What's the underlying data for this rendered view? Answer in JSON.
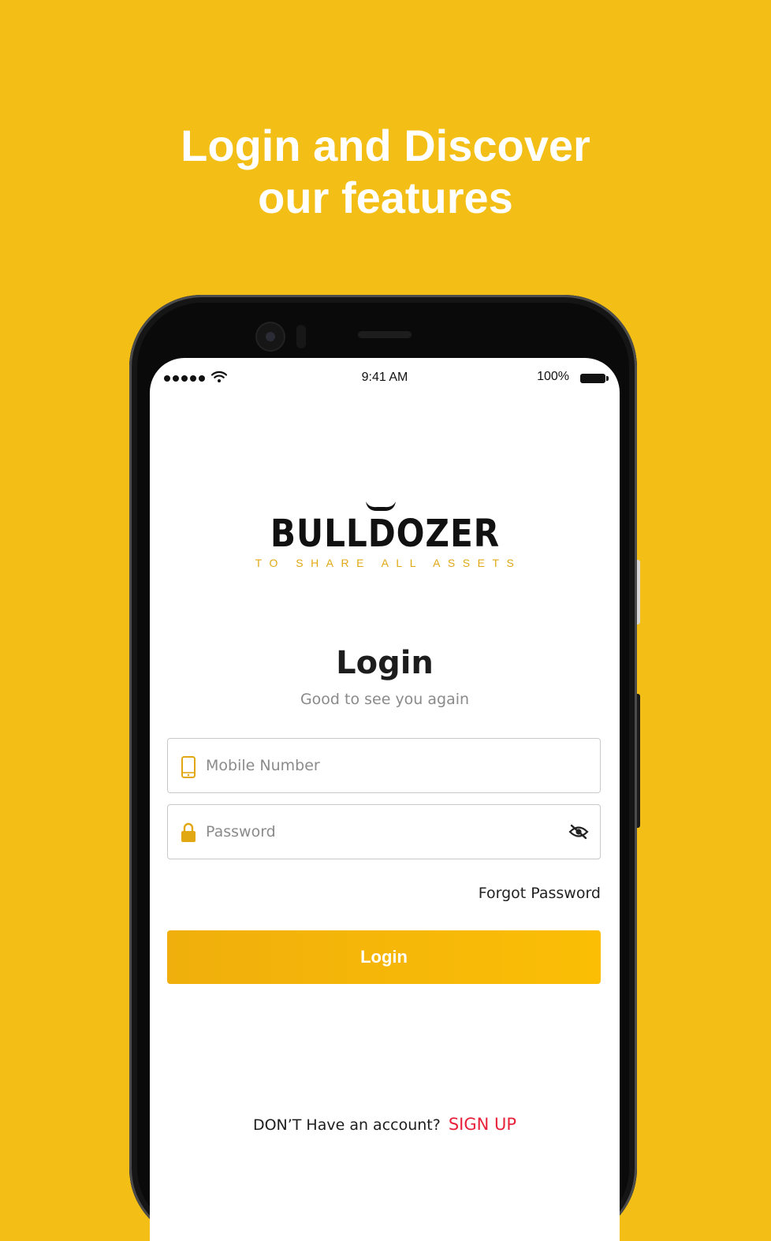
{
  "headline": {
    "line1": "Login and Discover",
    "line2": "our features"
  },
  "status_bar": {
    "time": "9:41 AM",
    "battery": "100%"
  },
  "logo": {
    "wordmark": "BULLDOZER",
    "tagline": "TO SHARE ALL ASSETS",
    "accent_color": "#e2a814"
  },
  "login": {
    "title": "Login",
    "subtitle": "Good to see you again",
    "mobile_placeholder": "Mobile Number",
    "password_placeholder": "Password",
    "forgot_label": "Forgot Password",
    "button_label": "Login",
    "no_account_text": "DON’T Have an account?",
    "signup_label": "SIGN UP"
  },
  "icons": {
    "mobile": "mobile-phone-icon",
    "lock": "lock-icon",
    "toggle_password": "eye-off-icon",
    "wifi": "wifi-icon",
    "battery": "battery-icon"
  },
  "colors": {
    "background": "#f3bf17",
    "button": "#f5b307",
    "signup": "#e8223a"
  }
}
